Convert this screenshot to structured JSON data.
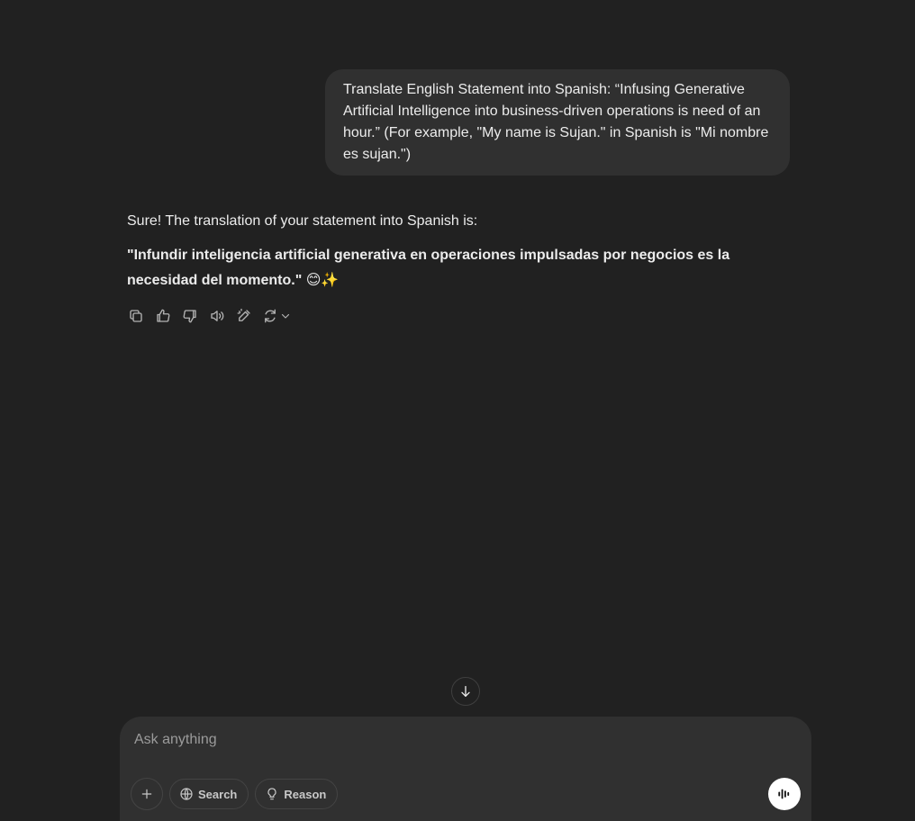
{
  "conversation": {
    "user_message": "Translate English Statement into Spanish: “Infusing Generative Artificial Intelligence into business-driven operations is need of an hour.” (For example, \"My name is Sujan.\" in Spanish is \"Mi nombre es sujan.\")",
    "assistant_intro": "Sure! The translation of your statement into Spanish is:",
    "assistant_translation": "\"Infundir inteligencia artificial generativa en operaciones impulsadas por negocios es la necesidad del momento.\" 😊✨"
  },
  "message_actions": [
    {
      "icon": "copy-icon"
    },
    {
      "icon": "thumbs-up-icon"
    },
    {
      "icon": "thumbs-down-icon"
    },
    {
      "icon": "read-aloud-icon"
    },
    {
      "icon": "edit-canvas-icon"
    },
    {
      "icon": "regenerate-icon"
    }
  ],
  "composer": {
    "placeholder": "Ask anything",
    "value": "",
    "search_label": "Search",
    "reason_label": "Reason"
  },
  "colors": {
    "background": "#212121",
    "bubble": "#303030",
    "text": "#ececec",
    "muted": "#b4b4b4",
    "voice_button": "#ffffff"
  }
}
